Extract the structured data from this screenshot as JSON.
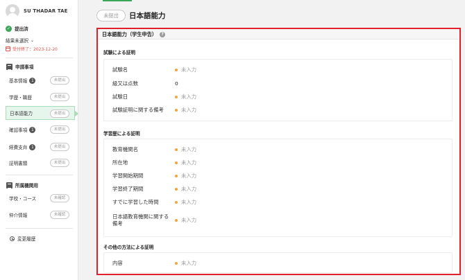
{
  "user": {
    "name": "SU THADAR TAE"
  },
  "sidebar": {
    "status": "提出済",
    "result": "結果未選択",
    "deadline": "受付終了：2023-12-20",
    "section1": "申請事項",
    "items": [
      {
        "label": "基本情報",
        "count": "1",
        "pill": "未提出"
      },
      {
        "label": "学歴・職歴",
        "count": "",
        "pill": "未提出"
      },
      {
        "label": "日本語能力",
        "count": "",
        "pill": "未提出"
      },
      {
        "label": "確認事項",
        "count": "1",
        "pill": "未提出"
      },
      {
        "label": "経費支弁",
        "count": "1",
        "pill": "未提出"
      },
      {
        "label": "証明書類",
        "count": "",
        "pill": "未提出"
      }
    ],
    "section2": "所属機関用",
    "items2": [
      {
        "label": "学校・コース",
        "pill": "未確認"
      },
      {
        "label": "仲介情報",
        "pill": "未確認"
      }
    ],
    "history": "変更履歴"
  },
  "main": {
    "badge": "未提出",
    "title": "日本語能力",
    "panel_title": "日本語能力（学生申告）",
    "sections": [
      {
        "heading": "試験による証明",
        "rows": [
          {
            "label": "試験名",
            "value": "未入力",
            "empty": true
          },
          {
            "label": "級又は点数",
            "value": "0",
            "empty": false
          },
          {
            "label": "試験日",
            "value": "未入力",
            "empty": true
          },
          {
            "label": "試験証明に関する備考",
            "value": "未入力",
            "empty": true
          }
        ]
      },
      {
        "heading": "学習歴による証明",
        "rows": [
          {
            "label": "教育機関名",
            "value": "未入力",
            "empty": true
          },
          {
            "label": "所在地",
            "value": "未入力",
            "empty": true
          },
          {
            "label": "学習開始期間",
            "value": "未入力",
            "empty": true
          },
          {
            "label": "学習終了期間",
            "value": "未入力",
            "empty": true
          },
          {
            "label": "すでに学習した時間",
            "value": "未入力",
            "empty": true
          },
          {
            "label": "日本語教育機関に関する備考",
            "value": "未入力",
            "empty": true
          }
        ]
      },
      {
        "heading": "その他の方法による証明",
        "rows": [
          {
            "label": "内容",
            "value": "未入力",
            "empty": true
          }
        ]
      }
    ]
  },
  "colors": {
    "accent": "#3aa657",
    "highlight_border": "#e0202a",
    "empty_dot": "#f2a43a",
    "deadline": "#d9534f"
  }
}
